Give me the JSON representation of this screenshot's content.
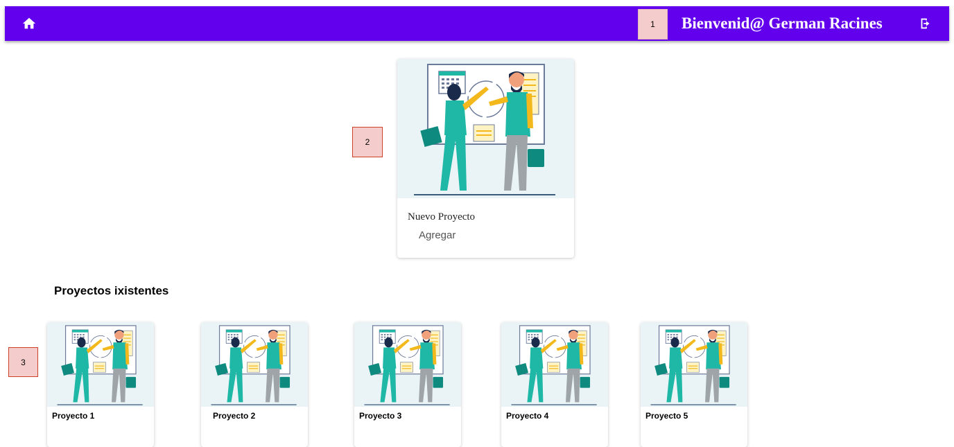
{
  "header": {
    "welcome_text": "Bienvenid@ German Racines",
    "home_icon": "home-icon",
    "logout_icon": "logout-icon",
    "background_color": "#6200ee"
  },
  "annotations": [
    "1",
    "2",
    "3"
  ],
  "new_project_card": {
    "title": "Nuevo Proyecto",
    "action_label": "Agregar"
  },
  "existing_section": {
    "title": "Proyectos ixistentes",
    "projects": [
      {
        "label": "Proyecto 1"
      },
      {
        "label": "Proyecto 2"
      },
      {
        "label": "Proyecto 3"
      },
      {
        "label": "Proyecto 4"
      },
      {
        "label": "Proyecto 5"
      }
    ]
  }
}
